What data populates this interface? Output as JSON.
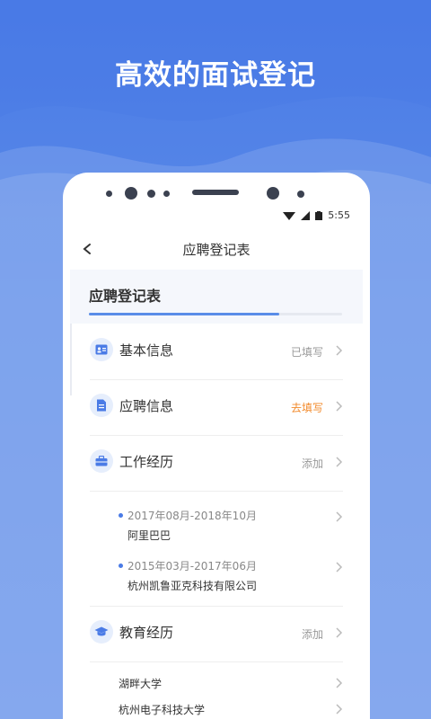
{
  "headline": "高效的面试登记",
  "status_bar": {
    "time": "5:55"
  },
  "nav": {
    "title": "应聘登记表"
  },
  "form": {
    "title": "应聘登记表",
    "progress": 0.75
  },
  "sections": [
    {
      "label": "基本信息",
      "status": "已填写",
      "icon": "id-card-icon"
    },
    {
      "label": "应聘信息",
      "status": "去填写",
      "icon": "document-icon"
    },
    {
      "label": "工作经历",
      "status": "添加",
      "icon": "briefcase-icon"
    },
    {
      "label": "教育经历",
      "status": "添加",
      "icon": "graduation-cap-icon"
    }
  ],
  "work_history": [
    {
      "dates": "2017年08月-2018年10月",
      "company": "阿里巴巴"
    },
    {
      "dates": "2015年03月-2017年06月",
      "company": "杭州凯鲁亚克科技有限公司"
    }
  ],
  "education": [
    {
      "school": "湖畔大学"
    },
    {
      "school": "杭州电子科技大学"
    }
  ],
  "colors": {
    "primary": "#4a7be6",
    "warning": "#f28a2b",
    "muted": "#999999"
  }
}
